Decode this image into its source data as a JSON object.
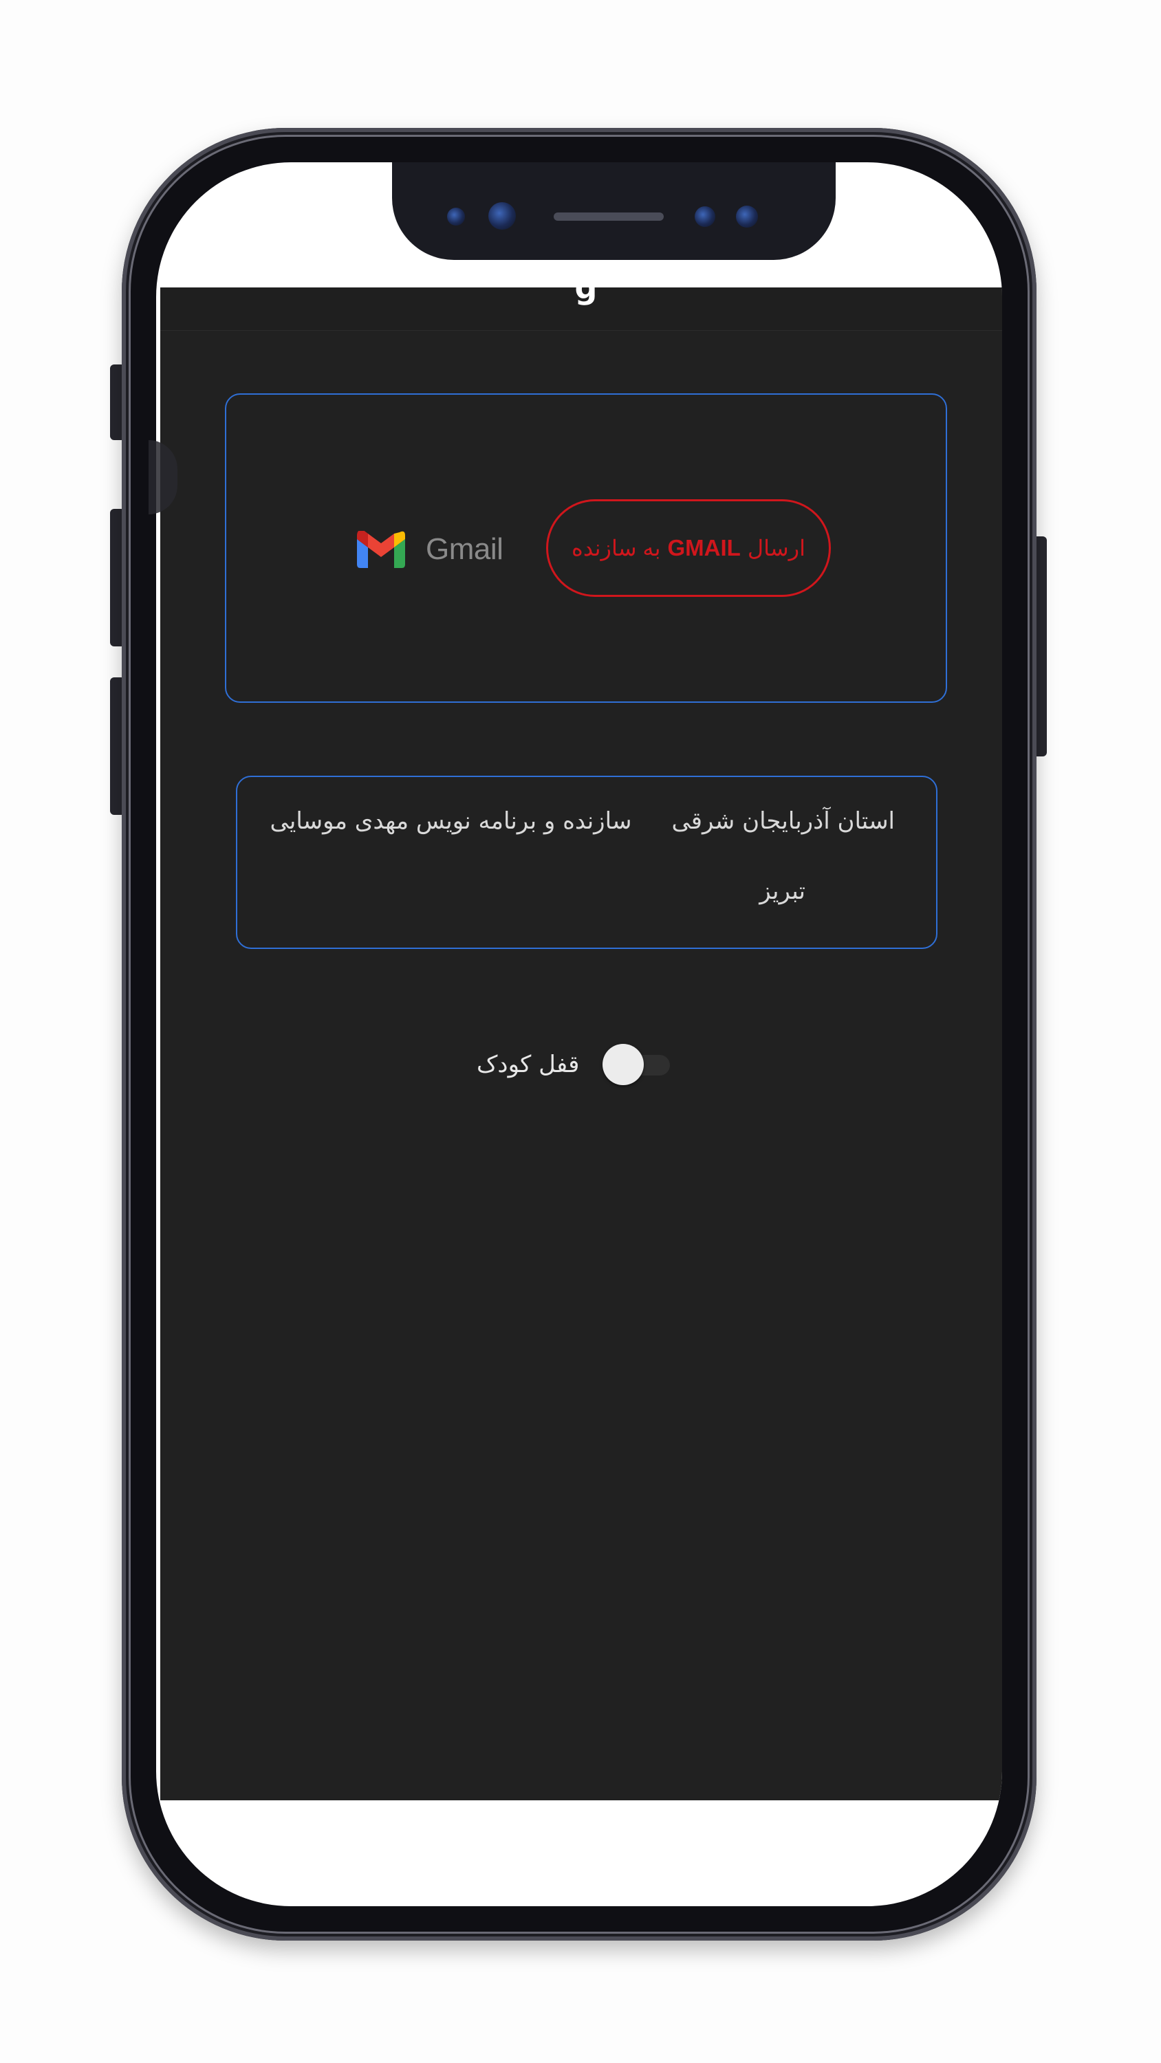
{
  "app": {
    "header_title": "g"
  },
  "gmail_card": {
    "logo_text": "Gmail",
    "send_button": {
      "prefix": "ارسال",
      "highlight": "GMAIL",
      "suffix": "به سازنده",
      "color": "#d0161c"
    }
  },
  "info_card": {
    "line1_part1": "استان آذربایجان شرقی",
    "line1_part2": "سازنده و برنامه نویس مهدی موسایی",
    "line2": "تبریز",
    "border_color": "#2f6fd6"
  },
  "child_lock": {
    "label": "قفل کودک",
    "state": "off"
  },
  "colors": {
    "screen_background": "#212121",
    "accent_blue": "#2f6fd6",
    "accent_red": "#d0161c"
  }
}
